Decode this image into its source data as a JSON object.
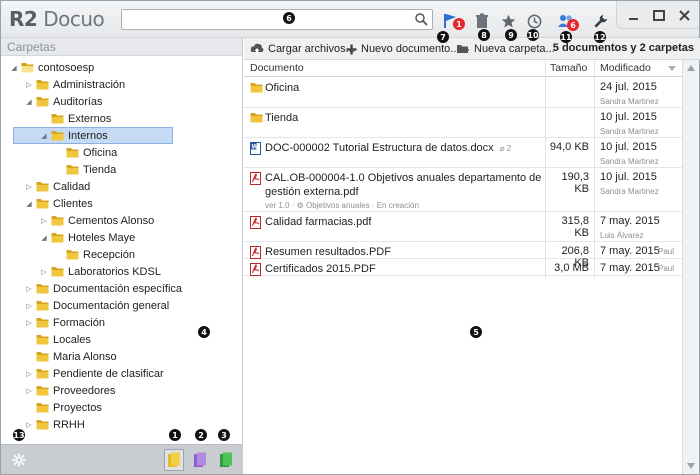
{
  "app": {
    "logo_r2": "R2",
    "logo_text": "Docuo"
  },
  "search": {
    "value": "",
    "placeholder": ""
  },
  "colors": {
    "accent": "#2f6fd4",
    "badge": "#e8262c",
    "folder": "#e8b829",
    "selection": "#c5dbf5"
  },
  "titlebar_icons": [
    {
      "name": "flag-icon",
      "badge": "1"
    },
    {
      "name": "trash-icon"
    },
    {
      "name": "star-icon"
    },
    {
      "name": "clock-icon"
    },
    {
      "name": "users-icon",
      "badge": "6"
    },
    {
      "name": "wrench-icon"
    }
  ],
  "callouts": [
    "1",
    "2",
    "3",
    "4",
    "5",
    "6",
    "7",
    "8",
    "9",
    "10",
    "11",
    "12",
    "13"
  ],
  "left_panel": {
    "title": "Carpetas"
  },
  "tree": [
    {
      "label": "contosoesp",
      "level": 0,
      "arrow": "open",
      "root": true
    },
    {
      "label": "Administración",
      "level": 1,
      "arrow": "closed"
    },
    {
      "label": "Auditorías",
      "level": 1,
      "arrow": "open"
    },
    {
      "label": "Externos",
      "level": 2,
      "arrow": "none"
    },
    {
      "label": "Internos",
      "level": 2,
      "arrow": "open",
      "selected": true
    },
    {
      "label": "Oficina",
      "level": 3,
      "arrow": "none"
    },
    {
      "label": "Tienda",
      "level": 3,
      "arrow": "none"
    },
    {
      "label": "Calidad",
      "level": 1,
      "arrow": "closed"
    },
    {
      "label": "Clientes",
      "level": 1,
      "arrow": "open"
    },
    {
      "label": "Cementos Alonso",
      "level": 2,
      "arrow": "closed"
    },
    {
      "label": "Hoteles Maye",
      "level": 2,
      "arrow": "open"
    },
    {
      "label": "Recepción",
      "level": 3,
      "arrow": "none"
    },
    {
      "label": "Laboratorios KDSL",
      "level": 2,
      "arrow": "closed"
    },
    {
      "label": "Documentación específica",
      "level": 1,
      "arrow": "closed"
    },
    {
      "label": "Documentación general",
      "level": 1,
      "arrow": "closed"
    },
    {
      "label": "Formación",
      "level": 1,
      "arrow": "closed"
    },
    {
      "label": "Locales",
      "level": 1,
      "arrow": "none"
    },
    {
      "label": "Maria Alonso",
      "level": 1,
      "arrow": "none"
    },
    {
      "label": "Pendiente de clasificar",
      "level": 1,
      "arrow": "closed"
    },
    {
      "label": "Proveedores",
      "level": 1,
      "arrow": "closed"
    },
    {
      "label": "Proyectos",
      "level": 1,
      "arrow": "none"
    },
    {
      "label": "RRHH",
      "level": 1,
      "arrow": "closed"
    }
  ],
  "toolbar": {
    "upload": "Cargar archivos...",
    "new_doc": "Nuevo documento...",
    "new_folder": "Nueva carpeta...",
    "count": "5 documentos y 2 carpetas"
  },
  "columns": {
    "document": "Documento",
    "size": "Tamaño",
    "modified": "Modificado"
  },
  "rows": [
    {
      "type": "folder",
      "name": "Oficina",
      "size": "",
      "date": "24 jul. 2015",
      "user": "Sandra Martinez"
    },
    {
      "type": "folder",
      "name": "Tienda",
      "size": "",
      "date": "10 jul. 2015",
      "user": "Sandra Martinez"
    },
    {
      "type": "docx",
      "name": "DOC-000002 Tutorial Estructura de datos.docx",
      "attach": "2",
      "size": "94,0 KB",
      "date": "10 jul. 2015",
      "user": "Sandra Martinez"
    },
    {
      "type": "pdf",
      "name": "CAL.OB-000004-1.0 Objetivos anuales departamento de gestión externa.pdf",
      "version": "ver 1.0",
      "meta": "Objetivos anuales · En creación",
      "size": "190,3 KB",
      "date": "10 jul. 2015",
      "user": "Sandra Martinez"
    },
    {
      "type": "pdf",
      "name": "Calidad farmacias.pdf",
      "size": "315,8 KB",
      "date": "7 may. 2015",
      "user": "Luis Álvarez"
    },
    {
      "type": "pdf",
      "name": "Resumen resultados.PDF",
      "size": "206,8 KB",
      "date": "7 may. 2015",
      "user": "Paul"
    },
    {
      "type": "pdf",
      "name": "Certificados 2015.PDF",
      "size": "3,0 MB",
      "date": "7 may. 2015",
      "user": "Paul"
    }
  ]
}
